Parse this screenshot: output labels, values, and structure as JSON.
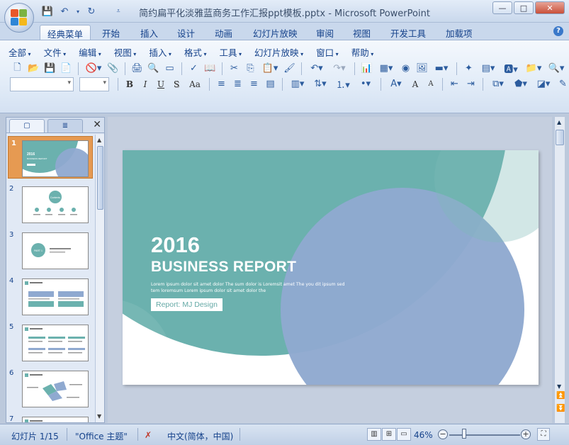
{
  "window": {
    "title": "简约扁平化淡雅蓝商务工作汇报ppt模板.pptx - Microsoft PowerPoint",
    "minimize": "—",
    "restore": "□",
    "close": "✕"
  },
  "quick_access": [
    "save-icon",
    "undo-icon",
    "redo-icon",
    "customize-icon"
  ],
  "tabs": [
    {
      "label": "经典菜单",
      "active": true
    },
    {
      "label": "开始"
    },
    {
      "label": "插入"
    },
    {
      "label": "设计"
    },
    {
      "label": "动画"
    },
    {
      "label": "幻灯片放映"
    },
    {
      "label": "审阅"
    },
    {
      "label": "视图"
    },
    {
      "label": "开发工具"
    },
    {
      "label": "加载项"
    }
  ],
  "help": "?",
  "menus": [
    "全部",
    "文件",
    "编辑",
    "视图",
    "插入",
    "格式",
    "工具",
    "幻灯片放映",
    "窗口",
    "帮助"
  ],
  "format_buttons": [
    "B",
    "I",
    "U",
    "S",
    "Aa"
  ],
  "font_size_buttons": [
    "A",
    "A"
  ],
  "panel": {
    "tab_slides": "▢",
    "tab_outline": "≣",
    "close": "✕"
  },
  "thumbnails": [
    {
      "num": "1",
      "selected": true,
      "title": "2016",
      "subtitle": "BUSINESS REPORT"
    },
    {
      "num": "2",
      "title": "Contents"
    },
    {
      "num": "3",
      "title": "PART 1"
    },
    {
      "num": "4"
    },
    {
      "num": "5"
    },
    {
      "num": "6"
    },
    {
      "num": "7"
    }
  ],
  "slide": {
    "year": "2016",
    "title": "BUSINESS REPORT",
    "lorem": "Lorem ipsum dolor sit amet dolor The sum dolor is Loremsit amet The you dit ipsum sed tem loremsum Lorem ipsum dolor sit amet dolor the",
    "report": "Report: MJ Design",
    "colors": {
      "teal": "#6bb1ae",
      "blue": "#8fa9d0"
    }
  },
  "status": {
    "slide_count": "幻灯片 1/15",
    "theme": "\"Office 主题\"",
    "language": "中文(简体，中国)",
    "zoom": "46%"
  }
}
